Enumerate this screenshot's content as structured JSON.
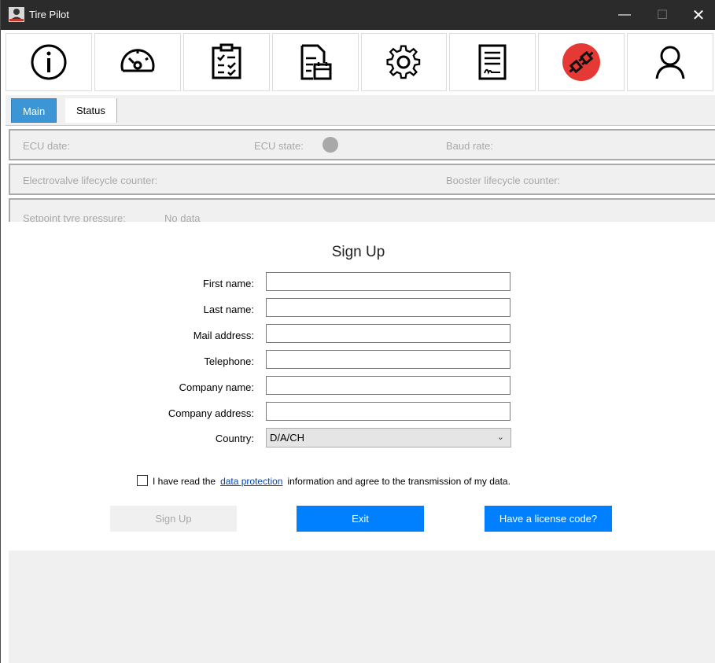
{
  "window": {
    "title": "Tire Pilot",
    "minimize": "—",
    "maximize": "☐",
    "close": "✕"
  },
  "toolbar": {
    "items": [
      "info-icon",
      "speedometer-icon",
      "checklist-icon",
      "document-calendar-icon",
      "settings-gear-icon",
      "signed-document-icon",
      "disconnected-plug-icon",
      "user-icon"
    ],
    "accent_plug_bg": "#e53935"
  },
  "tabs": [
    {
      "label": "Main"
    },
    {
      "label": "Status"
    }
  ],
  "info": {
    "ecu_date": "ECU date:",
    "ecu_state": "ECU state:",
    "baud_rate": "Baud rate:",
    "electrovalve": "Electrovalve lifecycle counter:",
    "booster": "Booster lifecycle counter:",
    "setpoint": "Setpoint tyre pressure:",
    "setpoint_value": "No data"
  },
  "signup": {
    "title": "Sign Up",
    "fields": [
      {
        "label": "First name:",
        "value": ""
      },
      {
        "label": "Last name:",
        "value": ""
      },
      {
        "label": "Mail address:",
        "value": ""
      },
      {
        "label": "Telephone:",
        "value": ""
      },
      {
        "label": "Company name:",
        "value": ""
      },
      {
        "label": "Company address:",
        "value": ""
      }
    ],
    "country_label": "Country:",
    "country_value": "D/A/CH",
    "agree_prefix": "I have read the",
    "agree_link": "data protection",
    "agree_suffix": "information and agree to the transmission of my data.",
    "btn_signup": "Sign Up",
    "btn_exit": "Exit",
    "btn_license": "Have a license code?"
  },
  "colors": {
    "accent_blue": "#0080ff",
    "tab_active": "#3c96d6",
    "titlebar": "#2b2b2b"
  }
}
